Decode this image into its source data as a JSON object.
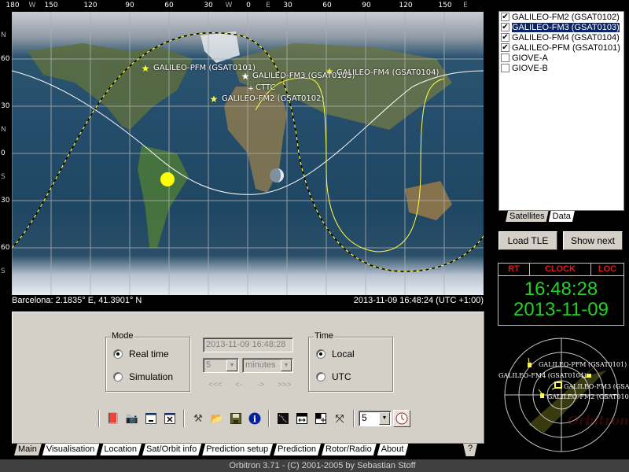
{
  "map": {
    "lon_ticks": [
      {
        "label": "180",
        "dir": false
      },
      {
        "label": "W",
        "dir": true
      },
      {
        "label": "150",
        "dir": false
      },
      {
        "label": "120",
        "dir": false
      },
      {
        "label": "90",
        "dir": false
      },
      {
        "label": "60",
        "dir": false
      },
      {
        "label": "30",
        "dir": false
      },
      {
        "label": "W",
        "dir": true
      },
      {
        "label": "0",
        "dir": false
      },
      {
        "label": "E",
        "dir": true
      },
      {
        "label": "30",
        "dir": false
      },
      {
        "label": "60",
        "dir": false
      },
      {
        "label": "90",
        "dir": false
      },
      {
        "label": "120",
        "dir": false
      },
      {
        "label": "150",
        "dir": false
      },
      {
        "label": "E",
        "dir": true
      }
    ],
    "lat_ticks": [
      {
        "label": "N",
        "dir": true
      },
      {
        "label": "60",
        "dir": false
      },
      {
        "label": "30",
        "dir": false
      },
      {
        "label": "N",
        "dir": true
      },
      {
        "label": "0",
        "dir": false
      },
      {
        "label": "S",
        "dir": true
      },
      {
        "label": "30",
        "dir": false
      },
      {
        "label": "60",
        "dir": false
      },
      {
        "label": "S",
        "dir": true
      }
    ],
    "satellites": [
      {
        "name": "GALILEO-PFM (GSAT0101)",
        "color": "#ffff40"
      },
      {
        "name": "GALILEO-FM3 (GSAT0103)",
        "color": "#ffffff"
      },
      {
        "name": "GALILEO-FM4 (GSAT0104)",
        "color": "#ffff40"
      },
      {
        "name": "GALILEO-FM2 (GSAT0102)",
        "color": "#ffff40"
      }
    ],
    "ground_station": "CTTC"
  },
  "status": {
    "location": "Barcelona: 2.1835° E, 41.3901° N",
    "datetime": "2013-11-09 16:48:24 (UTC +1:00)"
  },
  "main_panel": {
    "mode": {
      "title": "Mode",
      "options": [
        {
          "label": "Real time",
          "selected": true
        },
        {
          "label": "Simulation",
          "selected": false
        }
      ]
    },
    "sim_datetime": "2013-11-09 16:48:28",
    "step_value": "5",
    "step_unit": "minutes",
    "nav": [
      "<<<",
      "<-",
      "->",
      ">>>"
    ],
    "time": {
      "title": "Time",
      "options": [
        {
          "label": "Local",
          "selected": true
        },
        {
          "label": "UTC",
          "selected": false
        }
      ]
    },
    "toolbar": {
      "speed_value": "5",
      "icons": [
        "book-icon",
        "camera-icon",
        "minimize-icon",
        "close-window-icon",
        "tools-icon",
        "open-folder-icon",
        "save-icon",
        "info-icon",
        "track-icon",
        "fit-width-icon",
        "resize-icon",
        "fullscreen-icon",
        "clock-icon"
      ]
    }
  },
  "tabs": [
    "Main",
    "Visualisation",
    "Location",
    "Sat/Orbit info",
    "Prediction setup",
    "Prediction",
    "Rotor/Radio",
    "About"
  ],
  "help_tab": "?",
  "footer": "Orbitron 3.71 - (C) 2001-2005 by Sebastian Stoff",
  "satellite_list": [
    {
      "name": "GALILEO-FM2 (GSAT0102)",
      "checked": true,
      "selected": false
    },
    {
      "name": "GALILEO-FM3 (GSAT0103)",
      "checked": true,
      "selected": true
    },
    {
      "name": "GALILEO-FM4 (GSAT0104)",
      "checked": true,
      "selected": false
    },
    {
      "name": "GALILEO-PFM (GSAT0101)",
      "checked": true,
      "selected": false
    },
    {
      "name": "GIOVE-A",
      "checked": false,
      "selected": false
    },
    {
      "name": "GIOVE-B",
      "checked": false,
      "selected": false
    }
  ],
  "side_tabs": [
    "Satellites",
    "Data"
  ],
  "buttons": {
    "load_tle": "Load TLE",
    "show_next": "Show next"
  },
  "clock": {
    "rt": "RT",
    "label": "CLOCK",
    "loc": "LOC",
    "time": "16:48:28",
    "date": "2013-11-09",
    "color": "#22d322"
  },
  "radar": {
    "labels": [
      "GALILEO-PFM (GSAT0101)",
      "GALILEO-FM4 (GSAT0104)",
      "GALILEO-FM3 (GSA",
      "GALILEO-FM2 (GSAT010"
    ]
  }
}
